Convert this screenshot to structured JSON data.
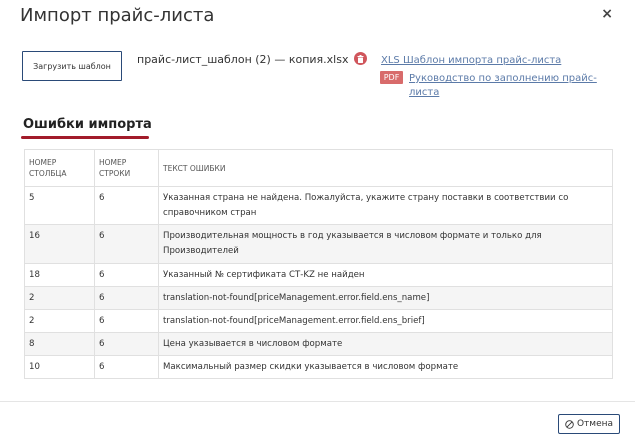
{
  "dialog": {
    "title": "Импорт прайс-листа",
    "close_glyph": "×"
  },
  "upload": {
    "button_label": "Загрузить шаблон",
    "file_name": "прайс-лист_шаблон (2) — копия.xlsx"
  },
  "links": {
    "xls_template": "XLS Шаблон импорта прайс-листа",
    "pdf_badge": "PDF",
    "pdf_guide": "Руководство по заполнению прайс-листа"
  },
  "errors_section": {
    "title": "Ошибки импорта",
    "accent_color": "#a21b2a",
    "columns": [
      "НОМЕР СТОЛБЦА",
      "НОМЕР СТРОКИ",
      "ТЕКСТ ОШИБКИ"
    ],
    "rows": [
      [
        "5",
        "6",
        "Указанная страна не найдена. Пожалуйста, укажите страну поставки в соответствии со справочником стран"
      ],
      [
        "16",
        "6",
        "Производительная мощность в год указывается в числовом формате и только для Производителей"
      ],
      [
        "18",
        "6",
        "Указанный № сертификата СТ-KZ не найден"
      ],
      [
        "2",
        "6",
        "translation-not-found[priceManagement.error.field.ens_name]"
      ],
      [
        "2",
        "6",
        "translation-not-found[priceManagement.error.field.ens_brief]"
      ],
      [
        "8",
        "6",
        "Цена указывается в числовом формате"
      ],
      [
        "10",
        "6",
        "Максимальный размер скидки указывается в числовом формате"
      ]
    ]
  },
  "footer": {
    "cancel_label": "Отмена"
  },
  "icons": {
    "delete": "trash-icon",
    "cancel": "cancel-circle-icon"
  }
}
